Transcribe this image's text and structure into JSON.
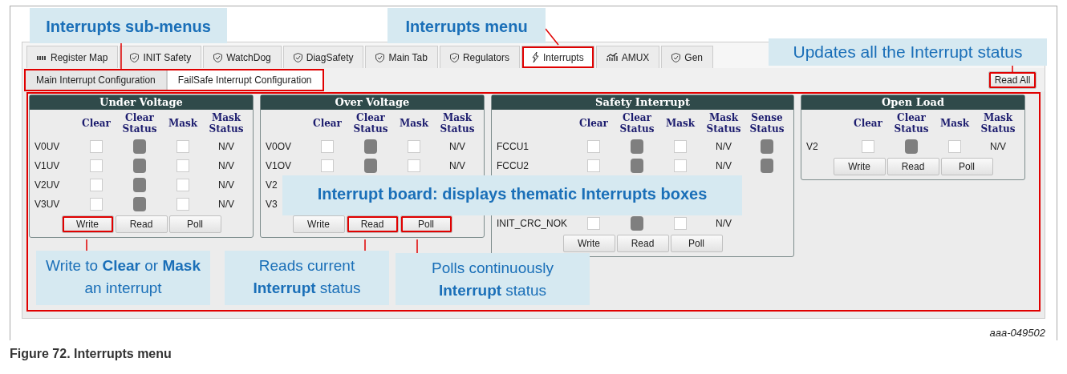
{
  "tabs": [
    {
      "label": "Register Map",
      "selected": false,
      "highlighted": false
    },
    {
      "label": "INIT Safety",
      "selected": false,
      "highlighted": false
    },
    {
      "label": "WatchDog",
      "selected": false,
      "highlighted": false
    },
    {
      "label": "DiagSafety",
      "selected": false,
      "highlighted": false
    },
    {
      "label": "Main Tab",
      "selected": false,
      "highlighted": false
    },
    {
      "label": "Regulators",
      "selected": false,
      "highlighted": false
    },
    {
      "label": "Interrupts",
      "selected": true,
      "highlighted": true
    },
    {
      "label": "AMUX",
      "selected": false,
      "highlighted": false
    },
    {
      "label": "Gen",
      "selected": false,
      "highlighted": false
    }
  ],
  "sub_tabs": {
    "highlighted": true,
    "items": [
      {
        "label": "Main Interrupt Configuration",
        "selected": false
      },
      {
        "label": "FailSafe Interrupt Configuration",
        "selected": true
      }
    ]
  },
  "read_all_button": {
    "label": "Read All",
    "highlighted": true
  },
  "board": {
    "highlighted": true,
    "panels": [
      {
        "title": "Under Voltage",
        "columns": [
          {
            "label": "Clear",
            "kind": "check"
          },
          {
            "label": "Clear Status",
            "kind": "led"
          },
          {
            "label": "Mask",
            "kind": "check"
          },
          {
            "label": "Mask Status",
            "kind": "text"
          }
        ],
        "rows": [
          {
            "label": "V0UV",
            "cells": [
              {
                "checked": false
              },
              {
                "on": false
              },
              {
                "checked": false
              },
              {
                "text": "N/V"
              }
            ]
          },
          {
            "label": "V1UV",
            "cells": [
              {
                "checked": false
              },
              {
                "on": false
              },
              {
                "checked": false
              },
              {
                "text": "N/V"
              }
            ]
          },
          {
            "label": "V2UV",
            "cells": [
              {
                "checked": false
              },
              {
                "on": false
              },
              {
                "checked": false
              },
              {
                "text": "N/V"
              }
            ]
          },
          {
            "label": "V3UV",
            "cells": [
              {
                "checked": false
              },
              {
                "on": false
              },
              {
                "checked": false
              },
              {
                "text": "N/V"
              }
            ]
          }
        ],
        "buttons": [
          {
            "label": "Write",
            "highlighted": true
          },
          {
            "label": "Read",
            "highlighted": false
          },
          {
            "label": "Poll",
            "highlighted": false
          }
        ]
      },
      {
        "title": "Over Voltage",
        "columns": [
          {
            "label": "Clear",
            "kind": "check"
          },
          {
            "label": "Clear Status",
            "kind": "led"
          },
          {
            "label": "Mask",
            "kind": "check"
          },
          {
            "label": "Mask Status",
            "kind": "text"
          }
        ],
        "rows": [
          {
            "label": "V0OV",
            "cells": [
              {
                "checked": false
              },
              {
                "on": false
              },
              {
                "checked": false
              },
              {
                "text": "N/V"
              }
            ]
          },
          {
            "label": "V1OV",
            "cells": [
              {
                "checked": false
              },
              {
                "on": false
              },
              {
                "checked": false
              },
              {
                "text": "N/V"
              }
            ]
          },
          {
            "label": "V2"
          },
          {
            "label": "V3"
          }
        ],
        "buttons": [
          {
            "label": "Write",
            "highlighted": false
          },
          {
            "label": "Read",
            "highlighted": true
          },
          {
            "label": "Poll",
            "highlighted": true
          }
        ]
      },
      {
        "title": "Safety Interrupt",
        "columns": [
          {
            "label": "Clear",
            "kind": "check"
          },
          {
            "label": "Clear Status",
            "kind": "led"
          },
          {
            "label": "Mask",
            "kind": "check"
          },
          {
            "label": "Mask Status",
            "kind": "text"
          },
          {
            "label": "Sense Status",
            "kind": "led"
          }
        ],
        "rows": [
          {
            "label": "FCCU1",
            "cells": [
              {
                "checked": false
              },
              {
                "on": false
              },
              {
                "checked": false
              },
              {
                "text": "N/V"
              },
              {
                "on": false
              }
            ]
          },
          {
            "label": "FCCU2",
            "cells": [
              {
                "checked": false
              },
              {
                "on": false
              },
              {
                "checked": false
              },
              {
                "text": "N/V"
              },
              {
                "on": false
              }
            ]
          },
          {
            "label": "INIT_CRC_NOK",
            "cells": [
              {
                "checked": false
              },
              {
                "on": false
              },
              {
                "checked": false
              },
              {
                "text": "N/V"
              }
            ]
          }
        ],
        "buttons": [
          {
            "label": "Write",
            "highlighted": false
          },
          {
            "label": "Read",
            "highlighted": false
          },
          {
            "label": "Poll",
            "highlighted": false
          }
        ]
      },
      {
        "title": "Open Load",
        "columns": [
          {
            "label": "Clear",
            "kind": "check"
          },
          {
            "label": "Clear Status",
            "kind": "led"
          },
          {
            "label": "Mask",
            "kind": "check"
          },
          {
            "label": "Mask Status",
            "kind": "text"
          }
        ],
        "rows": [
          {
            "label": "V2",
            "cells": [
              {
                "checked": false
              },
              {
                "on": false
              },
              {
                "checked": false
              },
              {
                "text": "N/V"
              }
            ]
          }
        ],
        "buttons": [
          {
            "label": "Write",
            "highlighted": false
          },
          {
            "label": "Read",
            "highlighted": false
          },
          {
            "label": "Poll",
            "highlighted": false
          }
        ]
      }
    ]
  },
  "callouts": [
    "Interrupts sub-menus",
    "Interrupts menu",
    "Updates all the Interrupt status",
    "Interrupt board: displays thematic Interrupts boxes",
    "Write to **Clear** or **Mask** an interrupt",
    "Reads current **Interrupt** status",
    "Polls continuously **Interrupt** status"
  ],
  "figure_id": "aaa-049502",
  "caption": "Figure 72.  Interrupts menu"
}
